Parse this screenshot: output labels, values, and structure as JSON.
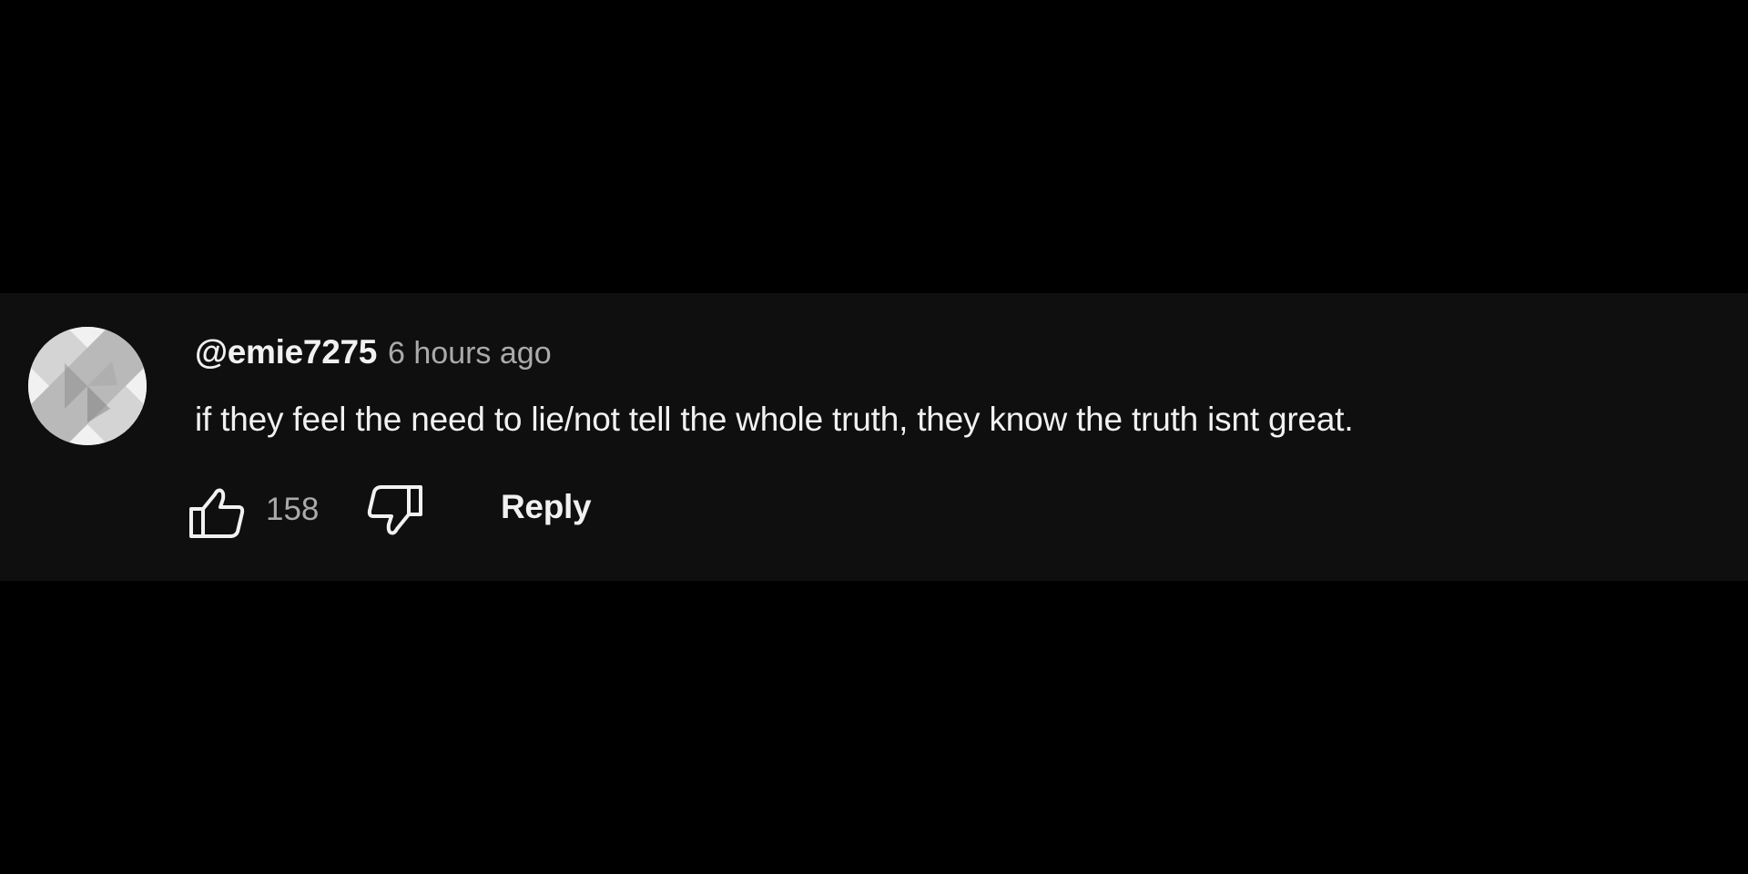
{
  "comment": {
    "author": "@emie7275",
    "timestamp": "6 hours ago",
    "text": "if they feel the need to lie/not tell the whole truth, they know the truth isnt great.",
    "likes": "158",
    "reply_label": "Reply",
    "avatar_icon": "avatar-x-icon",
    "like_icon": "thumbs-up-icon",
    "dislike_icon": "thumbs-down-icon"
  },
  "colors": {
    "page_background": "#000000",
    "panel_background": "#0f0f0f",
    "primary_text": "#f1f1f1",
    "secondary_text": "#aaaaaa"
  }
}
